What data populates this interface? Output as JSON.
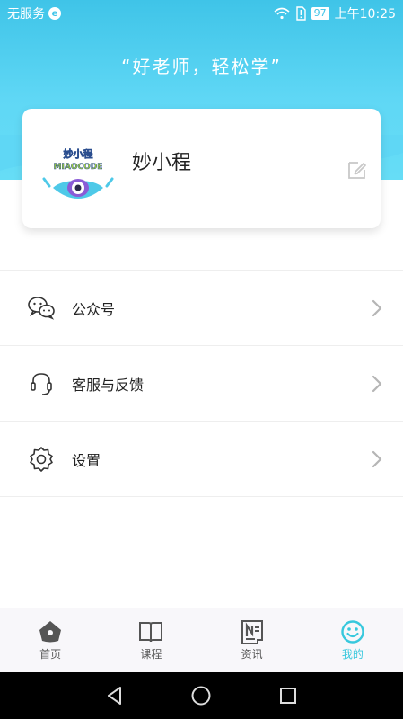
{
  "status_bar": {
    "carrier": "无服务",
    "battery": "97",
    "time": "上午10:25"
  },
  "header": {
    "slogan": "“好老师，轻松学”"
  },
  "profile": {
    "username": "妙小程",
    "avatar_text": "妙小程",
    "avatar_subtext": "MIAOCODE"
  },
  "menu": {
    "items": [
      {
        "label": "公众号",
        "icon": "wechat-icon"
      },
      {
        "label": "客服与反馈",
        "icon": "headset-icon"
      },
      {
        "label": "设置",
        "icon": "gear-icon"
      }
    ]
  },
  "tabs": [
    {
      "label": "首页",
      "icon": "home-icon",
      "active": false
    },
    {
      "label": "课程",
      "icon": "book-icon",
      "active": false
    },
    {
      "label": "资讯",
      "icon": "news-icon",
      "active": false
    },
    {
      "label": "我的",
      "icon": "smiley-icon",
      "active": true
    }
  ],
  "colors": {
    "header": "#4fd0f2",
    "accent": "#38c8dd"
  }
}
